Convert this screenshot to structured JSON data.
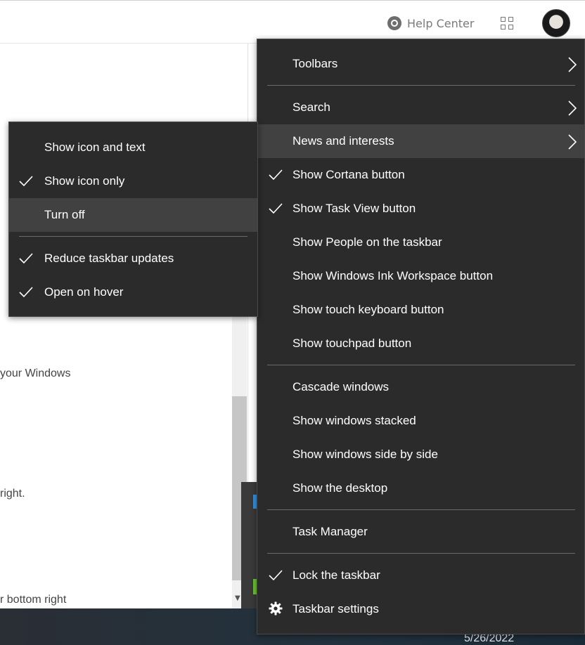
{
  "header": {
    "help_center": "Help Center"
  },
  "background": {
    "text_1": "your Windows",
    "text_2": "right.",
    "text_3": "r bottom right"
  },
  "taskbar": {
    "date": "5/26/2022"
  },
  "context_menu": {
    "items": [
      {
        "label": "Toolbars",
        "checked": false,
        "submenu": true
      },
      {
        "label": "Search",
        "checked": false,
        "submenu": true
      },
      {
        "label": "News and interests",
        "checked": false,
        "submenu": true,
        "highlighted": true
      },
      {
        "label": "Show Cortana button",
        "checked": true
      },
      {
        "label": "Show Task View button",
        "checked": true
      },
      {
        "label": "Show People on the taskbar",
        "checked": false
      },
      {
        "label": "Show Windows Ink Workspace button",
        "checked": false
      },
      {
        "label": "Show touch keyboard button",
        "checked": false
      },
      {
        "label": "Show touchpad button",
        "checked": false
      },
      {
        "label": "Cascade windows",
        "checked": false
      },
      {
        "label": "Show windows stacked",
        "checked": false
      },
      {
        "label": "Show windows side by side",
        "checked": false
      },
      {
        "label": "Show the desktop",
        "checked": false
      },
      {
        "label": "Task Manager",
        "checked": false
      },
      {
        "label": "Lock the taskbar",
        "checked": true
      },
      {
        "label": "Taskbar settings",
        "icon": "gear-icon"
      }
    ]
  },
  "news_submenu": {
    "items": [
      {
        "label": "Show icon and text",
        "checked": false
      },
      {
        "label": "Show icon only",
        "checked": true
      },
      {
        "label": "Turn off",
        "checked": false,
        "highlighted": true
      },
      {
        "label": "Reduce taskbar updates",
        "checked": true
      },
      {
        "label": "Open on hover",
        "checked": true
      }
    ]
  },
  "colors": {
    "menu_background": "#2b2b2b",
    "menu_highlight": "#414141",
    "menu_text": "#ffffff",
    "separator": "#6a6a6a"
  }
}
